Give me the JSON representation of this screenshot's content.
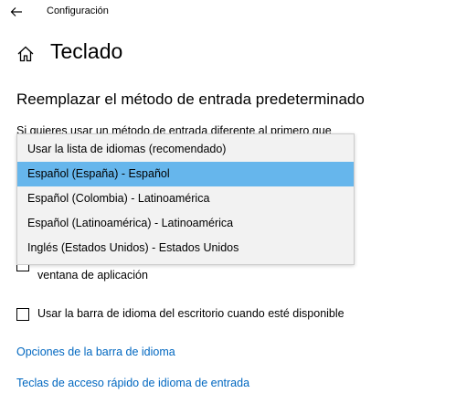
{
  "app": {
    "title": "Configuración"
  },
  "icons": {
    "back": "back-arrow-icon",
    "home": "home-icon"
  },
  "page": {
    "title": "Teclado"
  },
  "section": {
    "title": "Reemplazar el método de entrada predeterminado",
    "description": "Si quieres usar un método de entrada diferente al primero que"
  },
  "dropdown": {
    "selected_index": 1,
    "options": [
      "Usar la lista de idiomas (recomendado)",
      "Español (España) - Español",
      "Español (Colombia) - Latinoamérica",
      "Español (Latinoamérica) - Latinoamérica",
      "Inglés (Estados Unidos) - Estados Unidos"
    ]
  },
  "checkboxes": {
    "per_app_window_continuation": "ventana de aplicación",
    "language_bar": "Usar la barra de idioma del escritorio cuando esté disponible"
  },
  "links": {
    "language_bar_options": "Opciones de la barra de idioma",
    "input_hotkeys": "Teclas de acceso rápido de idioma de entrada"
  },
  "colors": {
    "selection": "#66b6ec",
    "link": "#0067c0"
  }
}
